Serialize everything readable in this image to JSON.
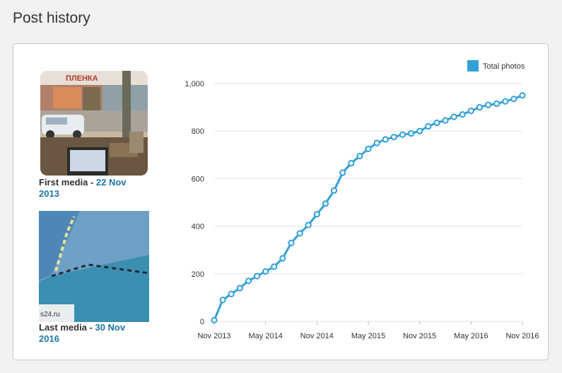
{
  "page": {
    "title": "Post history"
  },
  "first_media": {
    "label": "First media - ",
    "date": "22 Nov 2013",
    "image_sign_text": "ПЛЕНКА"
  },
  "last_media": {
    "label": "Last media - ",
    "date": "30 Nov 2016",
    "image_watermark": "s24.ru"
  },
  "colors": {
    "series": "#34a0d8",
    "accent_date": "#1b75a8",
    "grid": "#e3e3e3"
  },
  "chart_data": {
    "type": "line",
    "title": "",
    "xlabel": "",
    "ylabel": "",
    "ylim": [
      0,
      1000
    ],
    "yticks": [
      0,
      200,
      400,
      600,
      800,
      1000
    ],
    "ytick_labels": [
      "0",
      "200",
      "400",
      "600",
      "800",
      "1,000"
    ],
    "xticks": [
      "Nov 2013",
      "May 2014",
      "Nov 2014",
      "May 2015",
      "Nov 2015",
      "May 2016",
      "Nov 2016"
    ],
    "xlim": [
      "2013-11",
      "2016-11"
    ],
    "legend": {
      "position": "top-right",
      "entries": [
        "Total photos"
      ]
    },
    "grid": true,
    "series": [
      {
        "name": "Total photos",
        "color": "#34a0d8",
        "x": [
          "2013-11",
          "2013-12",
          "2014-01",
          "2014-02",
          "2014-03",
          "2014-04",
          "2014-05",
          "2014-06",
          "2014-07",
          "2014-08",
          "2014-09",
          "2014-10",
          "2014-11",
          "2014-12",
          "2015-01",
          "2015-02",
          "2015-03",
          "2015-04",
          "2015-05",
          "2015-06",
          "2015-07",
          "2015-08",
          "2015-09",
          "2015-10",
          "2015-11",
          "2015-12",
          "2016-01",
          "2016-02",
          "2016-03",
          "2016-04",
          "2016-05",
          "2016-06",
          "2016-07",
          "2016-08",
          "2016-09",
          "2016-10",
          "2016-11"
        ],
        "values": [
          5,
          90,
          115,
          140,
          170,
          190,
          210,
          230,
          265,
          330,
          370,
          405,
          450,
          495,
          550,
          625,
          665,
          695,
          725,
          750,
          765,
          775,
          785,
          790,
          800,
          820,
          835,
          845,
          860,
          870,
          885,
          900,
          910,
          915,
          925,
          935,
          950
        ]
      }
    ]
  }
}
